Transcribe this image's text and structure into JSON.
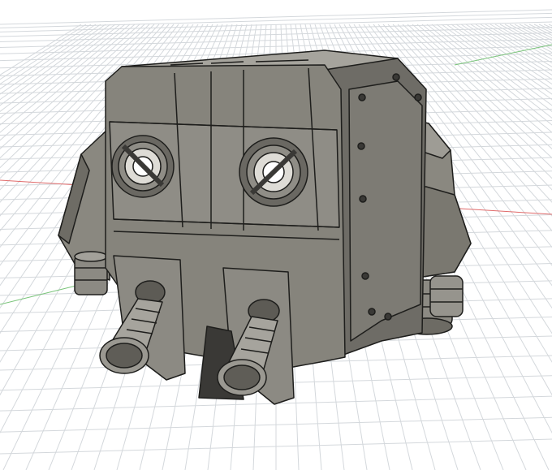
{
  "viewport": {
    "background": "#ffffff",
    "grid_color": "#d4d8dc",
    "axis_x_color": "#e06a6a",
    "axis_y_color": "#7ac47a"
  },
  "model": {
    "body_color": "#7c7a72",
    "panel_color": "#8a8880",
    "dark_color": "#3a3936",
    "edge_color": "#1e1e1c"
  }
}
